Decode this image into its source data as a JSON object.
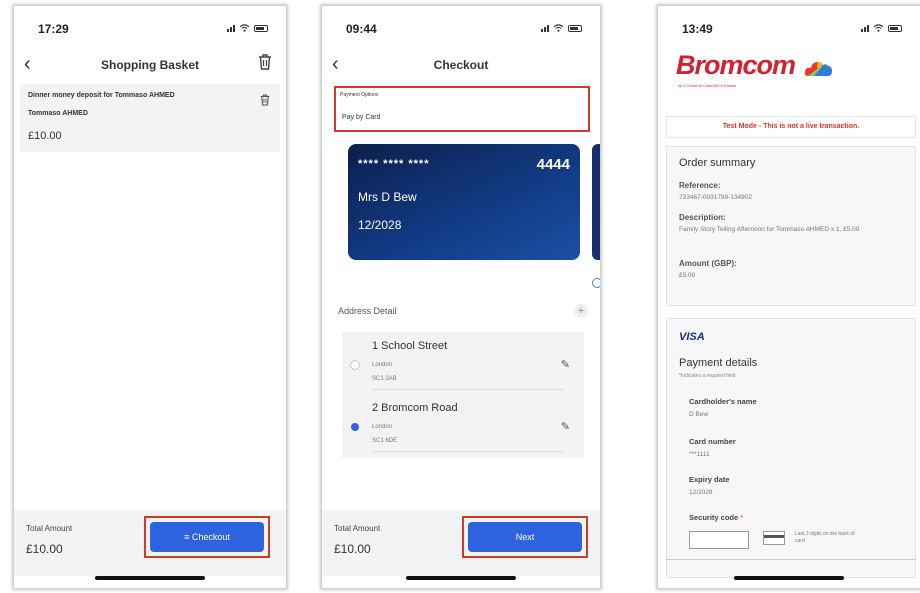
{
  "phone1": {
    "time": "17:29",
    "title": "Shopping Basket",
    "item": {
      "title": "Dinner money deposit for Tommaso AHMED",
      "name": "Tommaso AHMED",
      "price": "£10.00"
    },
    "total_label": "Total Amount",
    "total_amount": "£10.00",
    "checkout_label": "≡ Checkout"
  },
  "phone2": {
    "time": "09:44",
    "title": "Checkout",
    "payment_options_label": "Payment Options",
    "payment_option": "Pay by Card",
    "card": {
      "masked": "**** **** ****",
      "last4": "4444",
      "name": "Mrs D Bew",
      "expiry": "12/2028"
    },
    "address_heading": "Address Detail",
    "addresses": [
      {
        "street": "1 School Street",
        "city": "London",
        "postcode": "SC1 2AB",
        "selected": false
      },
      {
        "street": "2 Bromcom Road",
        "city": "London",
        "postcode": "SC1 6DE",
        "selected": true
      }
    ],
    "total_label": "Total Amount",
    "total_amount": "£10.00",
    "next_label": "Next"
  },
  "phone3": {
    "time": "13:49",
    "logo_text": "Bromcom",
    "logo_tagline": "No.1 Choice for Cloud MIS & Finance",
    "test_mode": "Test Mode - This is not a live transaction.",
    "summary": {
      "title": "Order summary",
      "reference_label": "Reference:",
      "reference": "733467-0031799-134902",
      "description_label": "Description:",
      "description": "Family Story Telling Afternoon for Tommaso AHMED x 1, £5.00",
      "amount_label": "Amount (GBP):",
      "amount": "£5.00"
    },
    "payment": {
      "card_brand": "VISA",
      "title": "Payment details",
      "required_note": "Indicates a required field",
      "cardholder_label": "Cardholder's name",
      "cardholder": "D Bew",
      "card_number_label": "Card number",
      "card_number": "***1111",
      "expiry_label": "Expiry date",
      "expiry": "12/2028",
      "security_label": "Security code",
      "security_hint": "Last 3 digits on the back of card"
    }
  },
  "colors": {
    "primary": "#2e63e0",
    "highlight": "#d23a25",
    "brand": "#d0232f",
    "card": "#113a82"
  }
}
